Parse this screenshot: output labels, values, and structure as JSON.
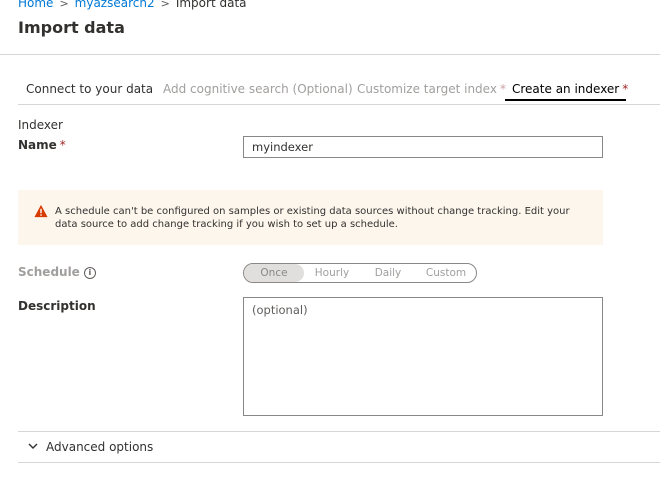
{
  "breadcrumb": {
    "home": "Home",
    "service": "myazsearch2",
    "current": "Import data"
  },
  "page": {
    "title": "Import data"
  },
  "tabs": [
    {
      "label": "Connect to your data",
      "required": ""
    },
    {
      "label": "Add cognitive search (Optional)",
      "required": ""
    },
    {
      "label": "Customize target index",
      "required": "*"
    },
    {
      "label": "Create an indexer",
      "required": "*"
    }
  ],
  "indexer": {
    "section_label": "Indexer",
    "name_label": "Name",
    "name_required": "*",
    "name_value": "myindexer"
  },
  "warning": {
    "icon": "warning-triangle-icon",
    "text": "A schedule can't be configured on samples or existing data sources without change tracking. Edit your data source to add change tracking if you wish to set up a schedule."
  },
  "schedule": {
    "label": "Schedule",
    "info_icon": "i",
    "options": [
      "Once",
      "Hourly",
      "Daily",
      "Custom"
    ],
    "selected": "Once"
  },
  "description": {
    "label": "Description",
    "placeholder": "(optional)"
  },
  "advanced": {
    "label": "Advanced options"
  },
  "colors": {
    "accent": "#0078d4",
    "required": "#a4262c",
    "warning_bg": "#fdf6ec",
    "warning_icon": "#d83b01"
  }
}
